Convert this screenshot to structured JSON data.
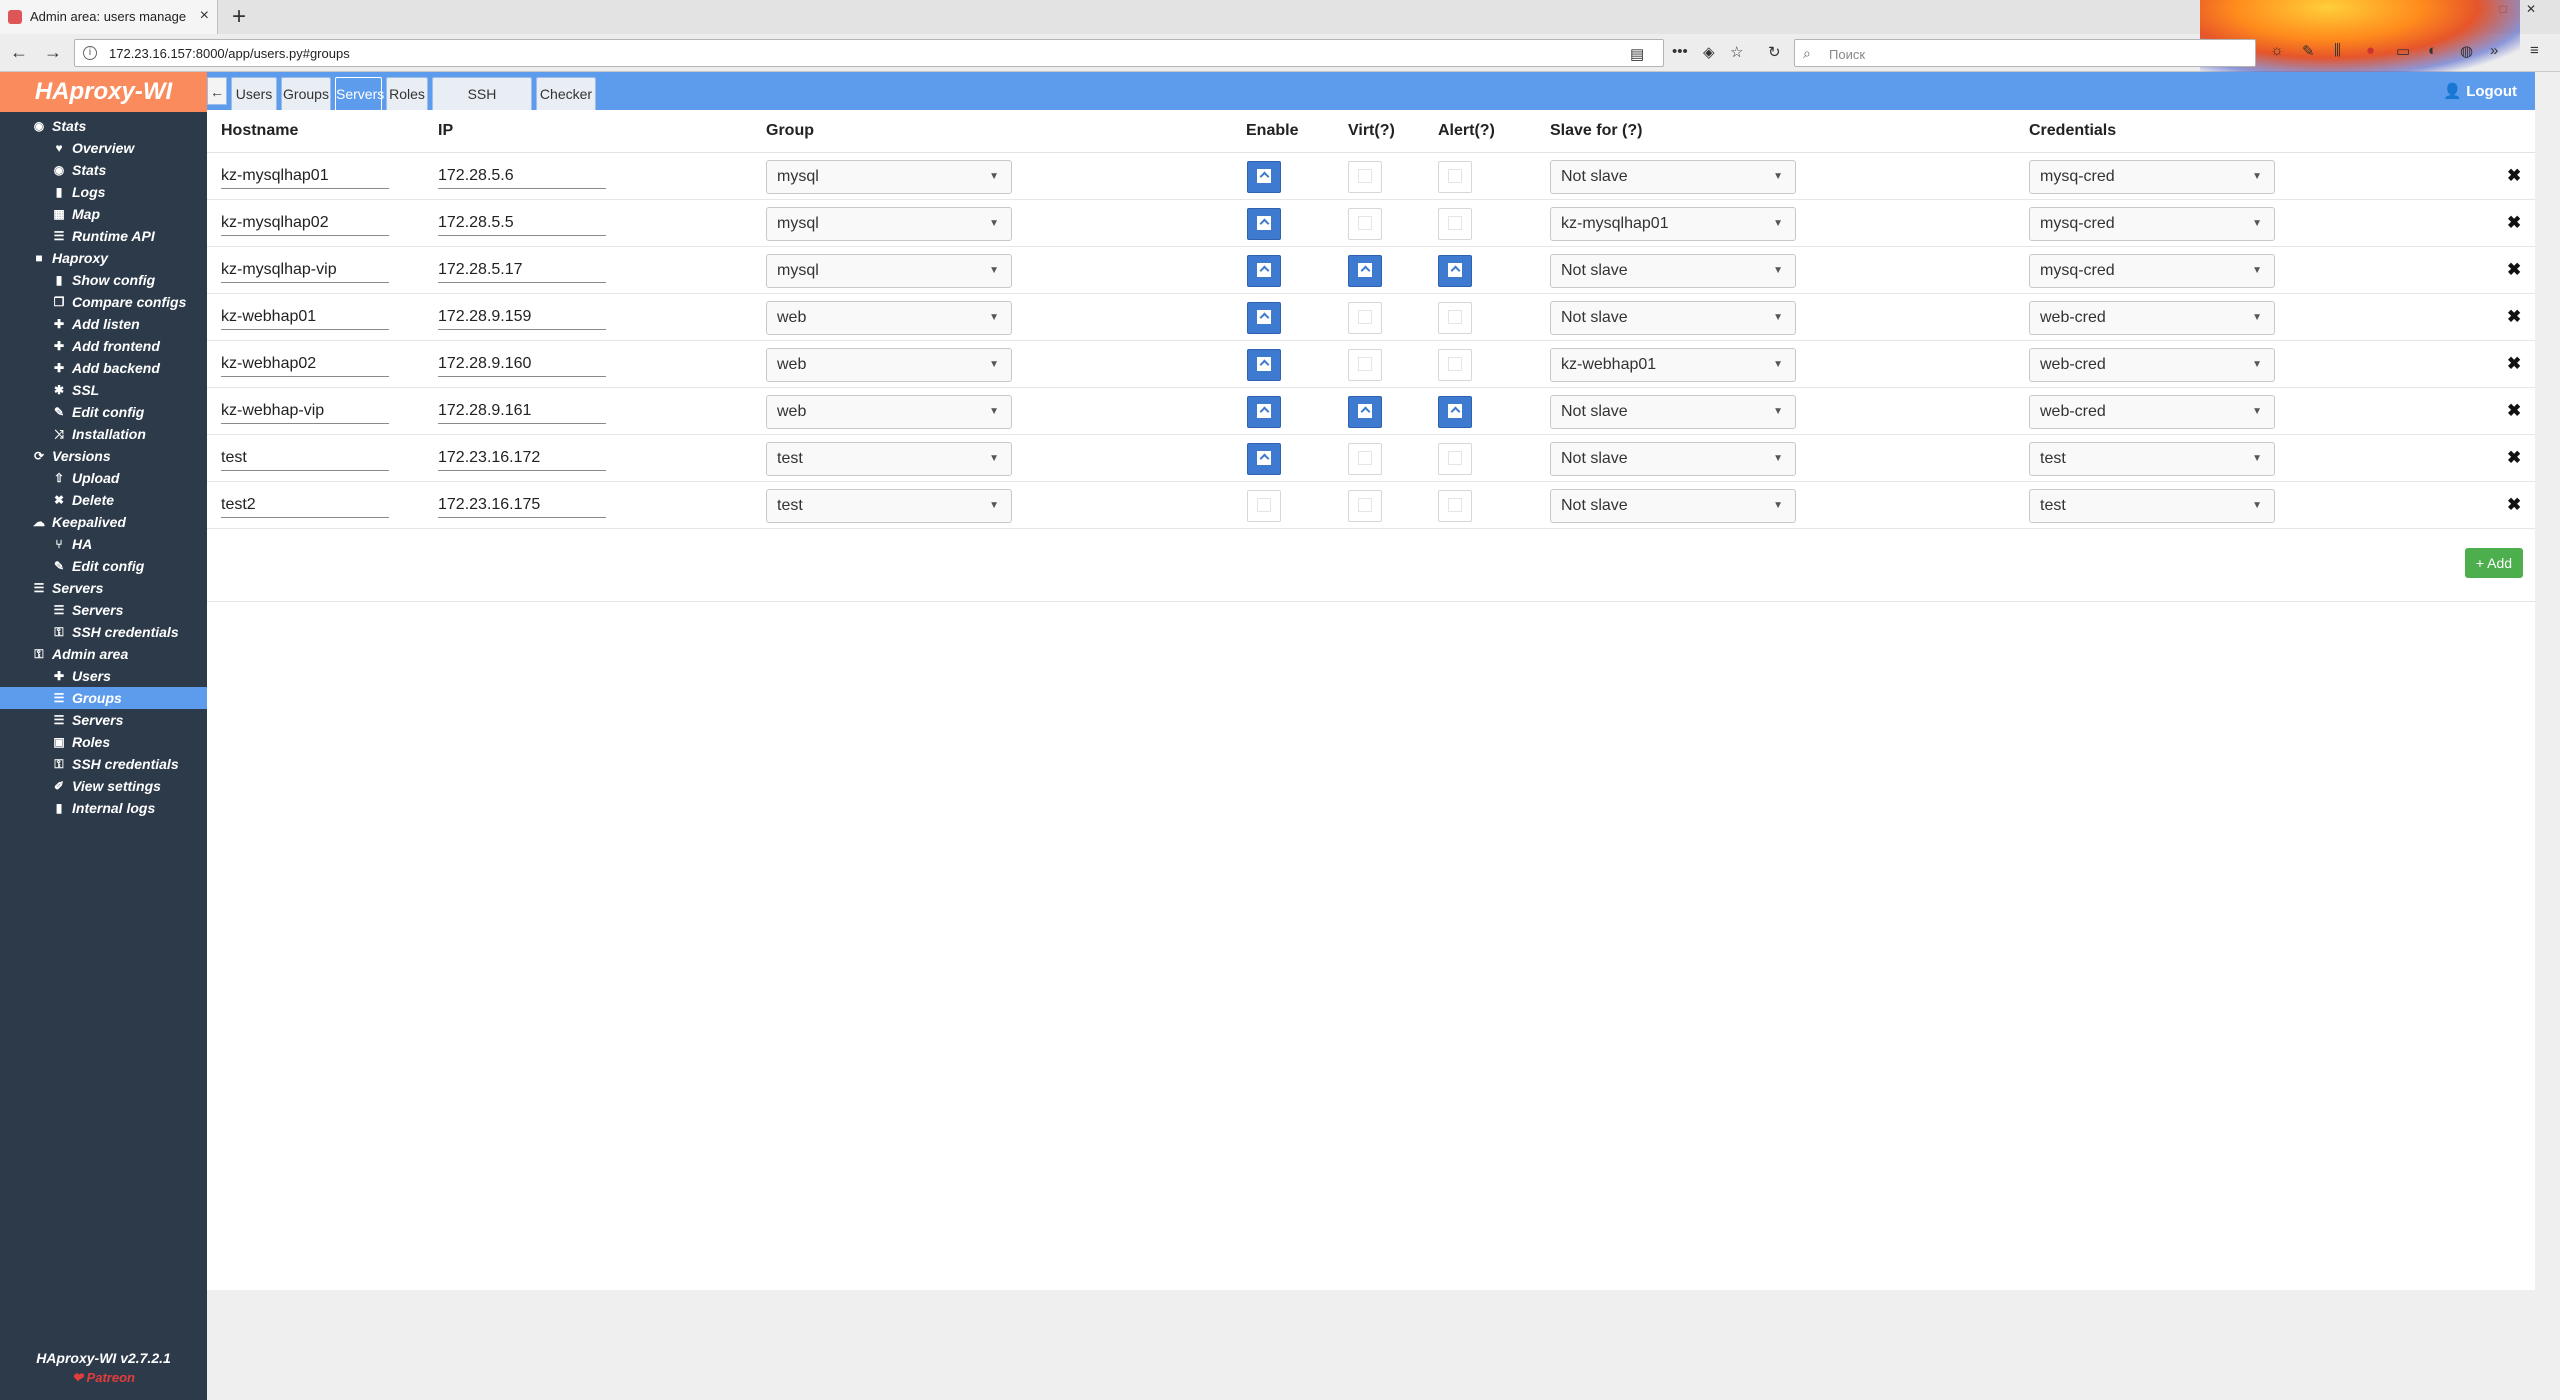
{
  "browser": {
    "tab_title": "Admin area: users manage - H",
    "new_tab": "+",
    "url": "172.23.16.157:8000/app/users.py#groups",
    "search_placeholder": "Поиск"
  },
  "sidebar": {
    "logo": "HAproxy-WI",
    "version": "HAproxy-WI v2.7.2.1",
    "patreon": "❤ Patreon",
    "items": [
      {
        "label": "Stats",
        "icon": "eye-icon",
        "level": 0
      },
      {
        "label": "Overview",
        "icon": "heartbeat-icon",
        "level": 1
      },
      {
        "label": "Stats",
        "icon": "eye-icon",
        "level": 1
      },
      {
        "label": "Logs",
        "icon": "file-icon",
        "level": 1
      },
      {
        "label": "Map",
        "icon": "map-icon",
        "level": 1
      },
      {
        "label": "Runtime API",
        "icon": "list-icon",
        "level": 1
      },
      {
        "label": "Haproxy",
        "icon": "square-icon",
        "level": 0
      },
      {
        "label": "Show config",
        "icon": "file-icon",
        "level": 1
      },
      {
        "label": "Compare configs",
        "icon": "copy-icon",
        "level": 1
      },
      {
        "label": "Add listen",
        "icon": "plus-icon",
        "level": 1
      },
      {
        "label": "Add frontend",
        "icon": "plus-icon",
        "level": 1
      },
      {
        "label": "Add backend",
        "icon": "plus-icon",
        "level": 1
      },
      {
        "label": "SSL",
        "icon": "cog-icon",
        "level": 1
      },
      {
        "label": "Edit config",
        "icon": "edit-icon",
        "level": 1
      },
      {
        "label": "Installation",
        "icon": "shuffle-icon",
        "level": 1
      },
      {
        "label": "Versions",
        "icon": "refresh-icon",
        "level": 0
      },
      {
        "label": "Upload",
        "icon": "upload-icon",
        "level": 1
      },
      {
        "label": "Delete",
        "icon": "times-icon",
        "level": 1
      },
      {
        "label": "Keepalived",
        "icon": "cloud-icon",
        "level": 0
      },
      {
        "label": "HA",
        "icon": "branch-icon",
        "level": 1
      },
      {
        "label": "Edit config",
        "icon": "edit-icon",
        "level": 1
      },
      {
        "label": "Servers",
        "icon": "server-icon",
        "level": 0
      },
      {
        "label": "Servers",
        "icon": "server-icon",
        "level": 1
      },
      {
        "label": "SSH credentials",
        "icon": "lock-icon",
        "level": 1
      },
      {
        "label": "Admin area",
        "icon": "lock-icon",
        "level": 0
      },
      {
        "label": "Users",
        "icon": "user-plus-icon",
        "level": 1
      },
      {
        "label": "Groups",
        "icon": "server-icon",
        "level": 1,
        "active": true
      },
      {
        "label": "Servers",
        "icon": "server-icon",
        "level": 1
      },
      {
        "label": "Roles",
        "icon": "id-card-icon",
        "level": 1
      },
      {
        "label": "SSH credentials",
        "icon": "lock-icon",
        "level": 1
      },
      {
        "label": "View settings",
        "icon": "wrench-icon",
        "level": 1
      },
      {
        "label": "Internal logs",
        "icon": "file-icon",
        "level": 1
      }
    ]
  },
  "topbar": {
    "toggle": "←",
    "tabs": [
      "Users",
      "Groups",
      "Servers",
      "Roles",
      "SSH credentials",
      "Checker"
    ],
    "active_tab": "Servers",
    "logout": "👤 Logout"
  },
  "table": {
    "headers": [
      "Hostname",
      "IP",
      "Group",
      "Enable",
      "Virt(?)",
      "Alert(?)",
      "Slave for (?)",
      "Credentials"
    ],
    "rows": [
      {
        "hostname": "kz-mysqlhap01",
        "ip": "172.28.5.6",
        "group": "mysql",
        "enable": true,
        "virt": false,
        "alert": false,
        "slave_for": "Not slave",
        "credentials": "mysq-cred"
      },
      {
        "hostname": "kz-mysqlhap02",
        "ip": "172.28.5.5",
        "group": "mysql",
        "enable": true,
        "virt": false,
        "alert": false,
        "slave_for": "kz-mysqlhap01",
        "credentials": "mysq-cred"
      },
      {
        "hostname": "kz-mysqlhap-vip",
        "ip": "172.28.5.17",
        "group": "mysql",
        "enable": true,
        "virt": true,
        "alert": true,
        "slave_for": "Not slave",
        "credentials": "mysq-cred"
      },
      {
        "hostname": "kz-webhap01",
        "ip": "172.28.9.159",
        "group": "web",
        "enable": true,
        "virt": false,
        "alert": false,
        "slave_for": "Not slave",
        "credentials": "web-cred"
      },
      {
        "hostname": "kz-webhap02",
        "ip": "172.28.9.160",
        "group": "web",
        "enable": true,
        "virt": false,
        "alert": false,
        "slave_for": "kz-webhap01",
        "credentials": "web-cred"
      },
      {
        "hostname": "kz-webhap-vip",
        "ip": "172.28.9.161",
        "group": "web",
        "enable": true,
        "virt": true,
        "alert": true,
        "slave_for": "Not slave",
        "credentials": "web-cred"
      },
      {
        "hostname": "test",
        "ip": "172.23.16.172",
        "group": "test",
        "enable": true,
        "virt": false,
        "alert": false,
        "slave_for": "Not slave",
        "credentials": "test"
      },
      {
        "hostname": "test2",
        "ip": "172.23.16.175",
        "group": "test",
        "enable": false,
        "virt": false,
        "alert": false,
        "slave_for": "Not slave",
        "credentials": "test"
      }
    ],
    "delete_glyph": "✖",
    "add_button": "+ Add"
  },
  "colors": {
    "accent": "#5d9cec",
    "sidebar_bg": "#2d3a4a",
    "logo_bg": "#f98b5c",
    "add_green": "#4cae4c"
  }
}
